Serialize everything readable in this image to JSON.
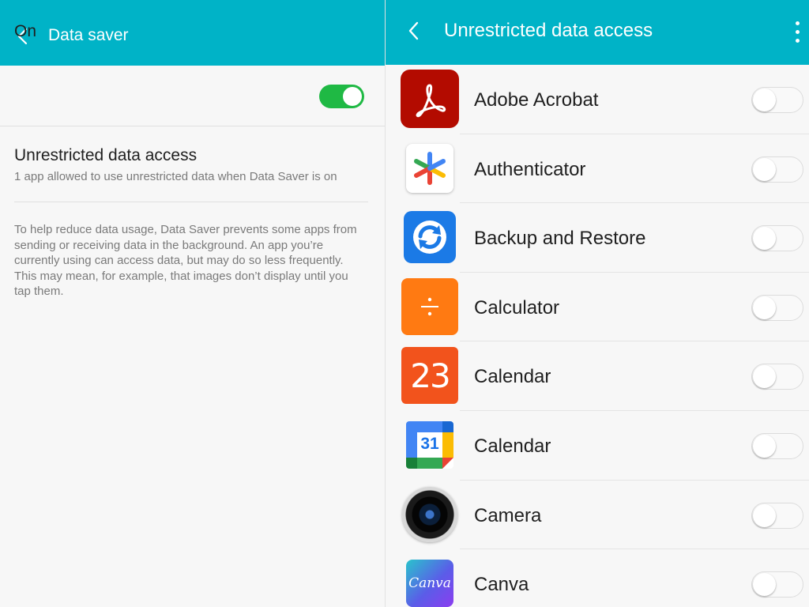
{
  "left_pane": {
    "title": "Data saver",
    "on_label": "On",
    "toggle_on": true,
    "unrestricted": {
      "title": "Unrestricted data access",
      "subtitle": "1 app allowed to use unrestricted data when Data Saver is on"
    },
    "help_text": "To help reduce data usage, Data Saver prevents some apps from sending or receiving data in the background. An app you’re currently using can access data, but may do so less frequently. This may mean, for example, that images don’t display until you tap them."
  },
  "right_pane": {
    "title": "Unrestricted data access",
    "apps": [
      {
        "name": "Adobe Acrobat",
        "icon": "adobe-acrobat-icon",
        "enabled": false
      },
      {
        "name": "Authenticator",
        "icon": "authenticator-icon",
        "enabled": false
      },
      {
        "name": "Backup and Restore",
        "icon": "backup-restore-icon",
        "enabled": false
      },
      {
        "name": "Calculator",
        "icon": "calculator-icon",
        "enabled": false,
        "glyph": "÷"
      },
      {
        "name": "Calendar",
        "icon": "calendar-23-icon",
        "enabled": false,
        "glyph": "23"
      },
      {
        "name": "Calendar",
        "icon": "google-calendar-icon",
        "enabled": false,
        "glyph": "31"
      },
      {
        "name": "Camera",
        "icon": "camera-icon",
        "enabled": false
      },
      {
        "name": "Canva",
        "icon": "canva-icon",
        "enabled": false,
        "glyph": "Canva"
      }
    ]
  },
  "colors": {
    "header": "#00b3c7",
    "toggle_on": "#1fb944",
    "background": "#f7f7f7"
  }
}
